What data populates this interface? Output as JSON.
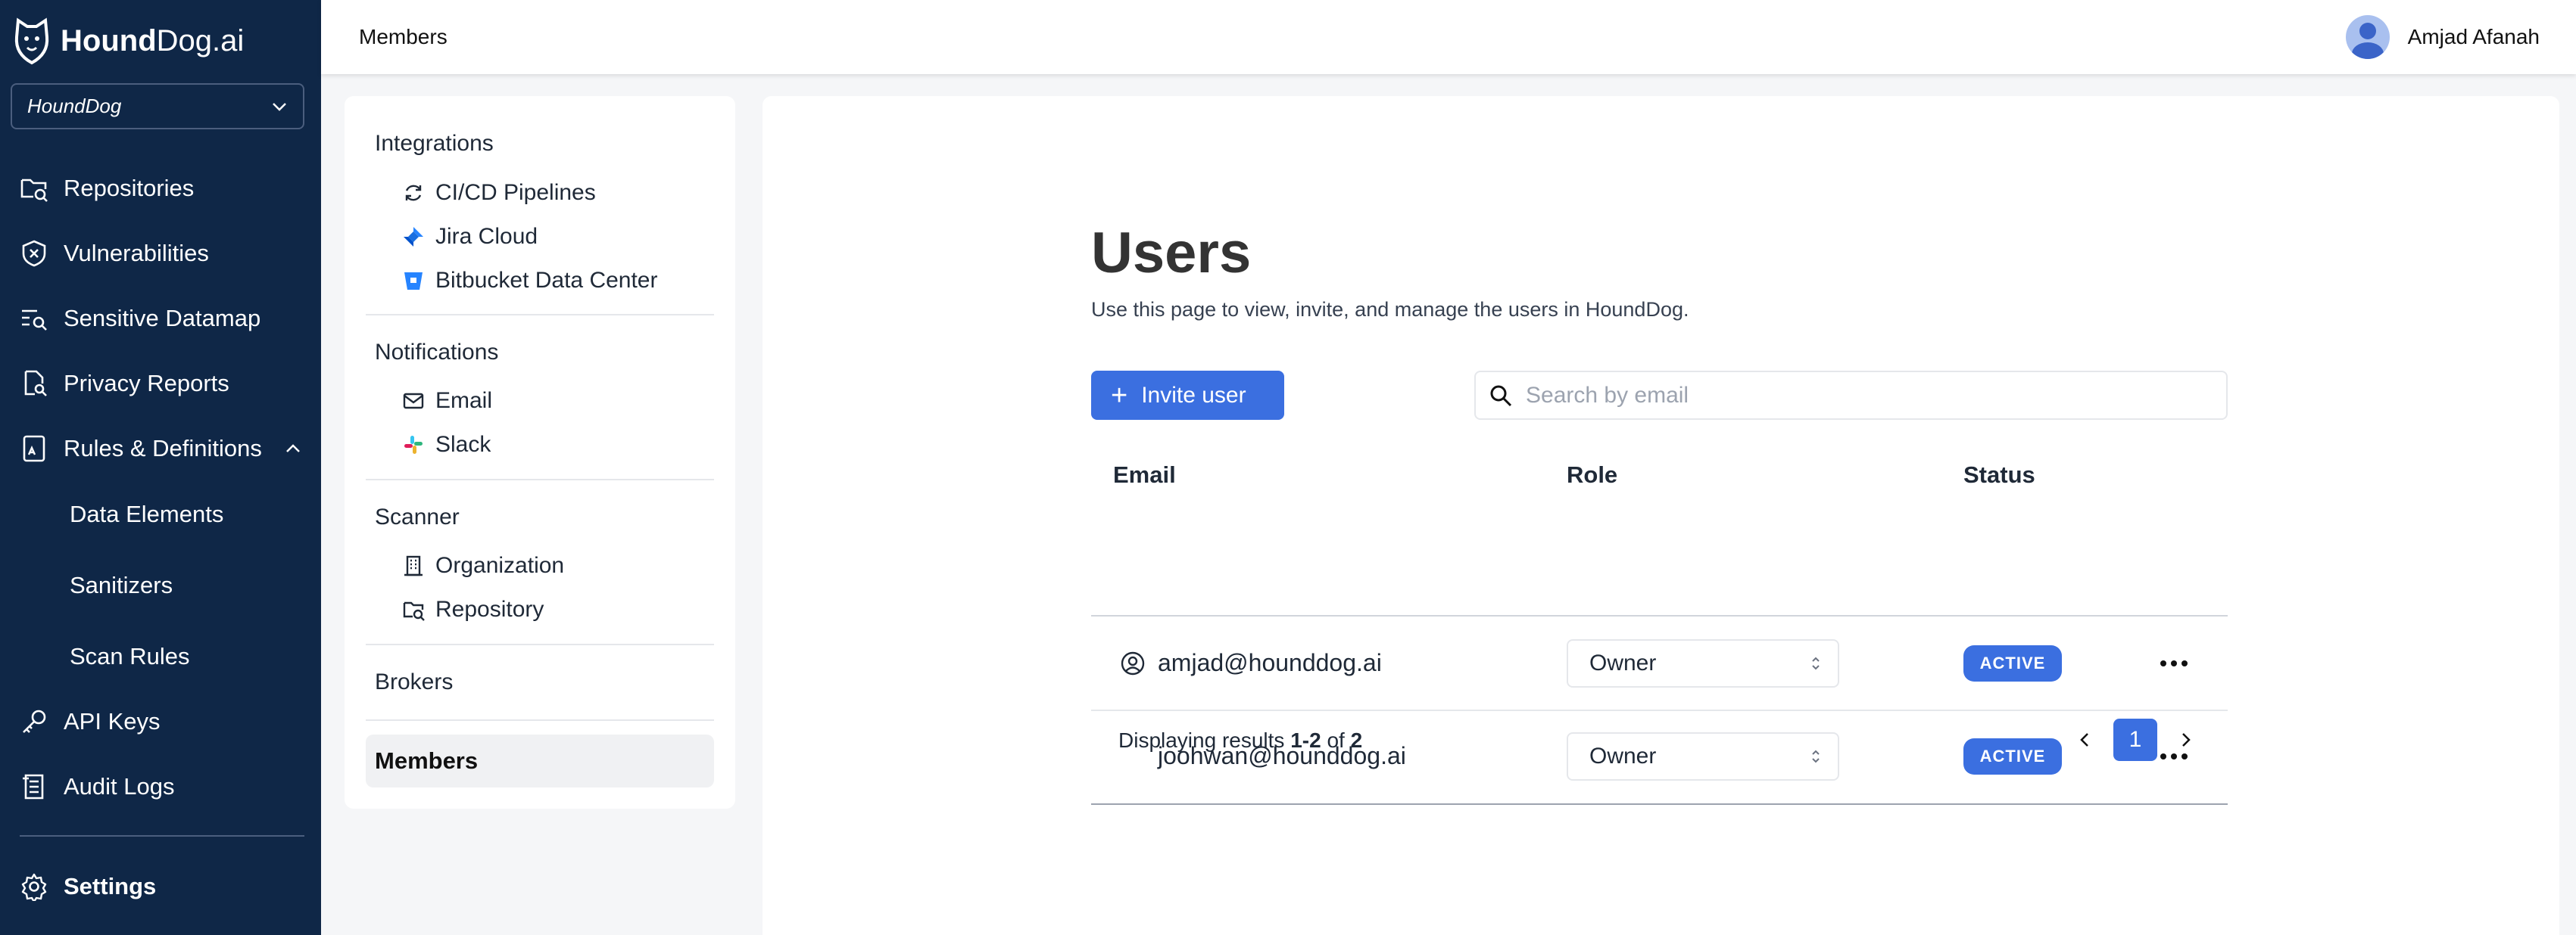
{
  "app": {
    "brand_bold": "Hound",
    "brand_rest": "Dog.ai",
    "org_selected": "HoundDog"
  },
  "sidebar": {
    "items": [
      {
        "label": "Repositories",
        "icon": "folder-search-icon"
      },
      {
        "label": "Vulnerabilities",
        "icon": "shield-icon"
      },
      {
        "label": "Sensitive Datamap",
        "icon": "list-search-icon"
      },
      {
        "label": "Privacy Reports",
        "icon": "document-search-icon"
      },
      {
        "label": "Rules & Definitions",
        "icon": "rules-icon",
        "expanded": true
      },
      {
        "label": "API Keys",
        "icon": "key-icon"
      },
      {
        "label": "Audit Logs",
        "icon": "log-icon"
      },
      {
        "label": "Settings",
        "icon": "gear-icon",
        "active": true
      }
    ],
    "sub_items": [
      "Data Elements",
      "Sanitizers",
      "Scan Rules"
    ]
  },
  "topbar": {
    "breadcrumb": "Members",
    "user_name": "Amjad Afanah"
  },
  "settings_menu": {
    "integrations_title": "Integrations",
    "integrations": [
      "CI/CD Pipelines",
      "Jira Cloud",
      "Bitbucket Data Center"
    ],
    "notifications_title": "Notifications",
    "notifications": [
      "Email",
      "Slack"
    ],
    "scanner_title": "Scanner",
    "scanner": [
      "Organization",
      "Repository"
    ],
    "brokers": "Brokers",
    "members": "Members"
  },
  "main": {
    "title": "Users",
    "description": "Use this page to view, invite, and manage the users in HoundDog.",
    "invite_button": "Invite user",
    "search_placeholder": "Search by email",
    "columns": [
      "Email",
      "Role",
      "Status"
    ],
    "rows": [
      {
        "email": "amjad@hounddog.ai",
        "role": "Owner",
        "status": "ACTIVE",
        "is_current_user": true
      },
      {
        "email": "joohwan@hounddog.ai",
        "role": "Owner",
        "status": "ACTIVE",
        "is_current_user": false
      }
    ],
    "results_prefix": "Displaying results ",
    "results_range": "1-2",
    "results_of": " of ",
    "results_total": "2",
    "current_page": "1"
  },
  "colors": {
    "sidebar_bg": "#0f2747",
    "accent": "#3b6fe0"
  }
}
